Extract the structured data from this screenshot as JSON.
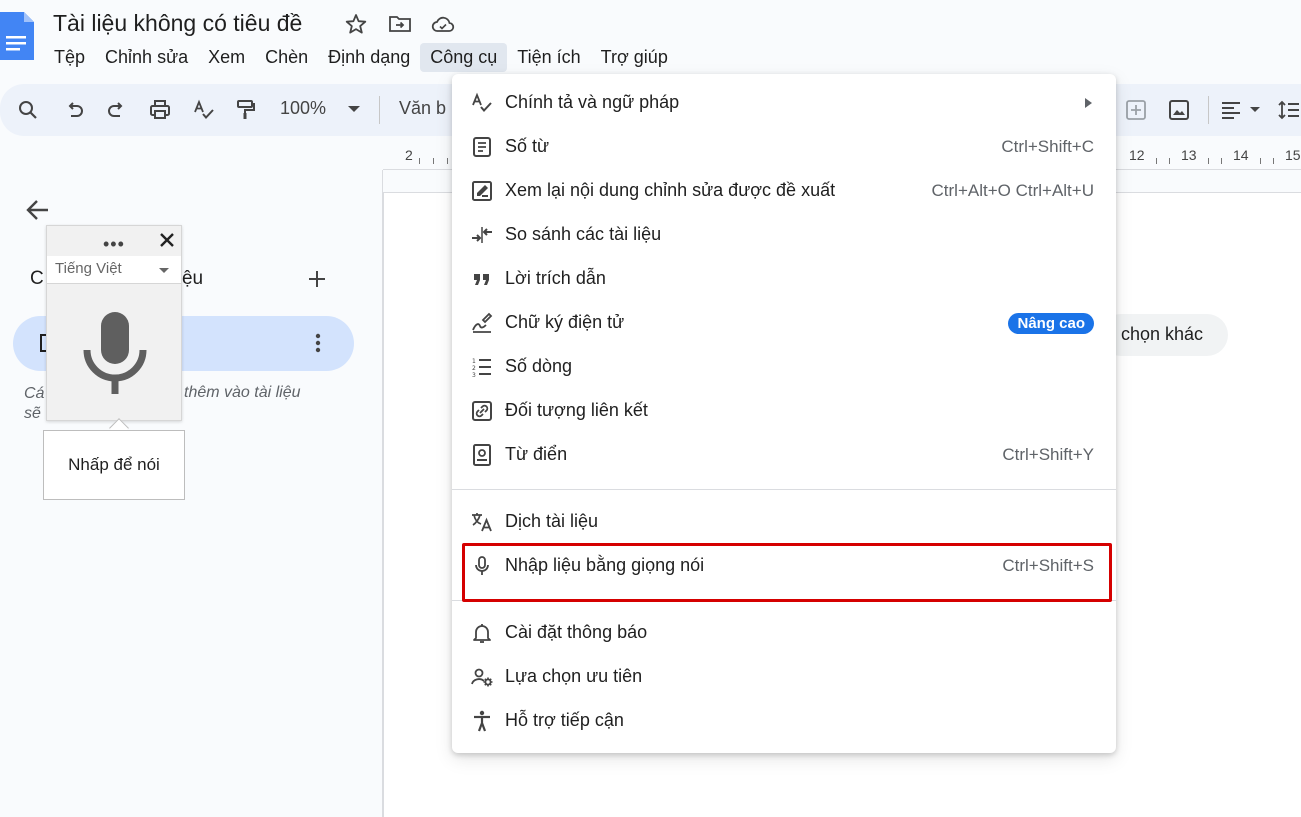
{
  "document": {
    "title": "Tài liệu không có tiêu đề"
  },
  "menubar": {
    "items": [
      "Tệp",
      "Chỉnh sửa",
      "Xem",
      "Chèn",
      "Định dạng",
      "Công cụ",
      "Tiện ích",
      "Trợ giúp"
    ],
    "active": "Công cụ"
  },
  "toolbar": {
    "zoom": "100%",
    "style_label": "Văn b"
  },
  "ruler": {
    "numbers": [
      "2",
      "12",
      "13",
      "14",
      "15"
    ]
  },
  "left_panel": {
    "heading_start": "C",
    "heading_end": "i liệu",
    "hint_start": "Cá",
    "hint_line2": "sẽ",
    "hint_end": "thêm vào tài liệu"
  },
  "page": {
    "chip_label": "chọn khác"
  },
  "voice_widget": {
    "dots": "•••",
    "language": "Tiếng Việt",
    "tooltip": "Nhấp để nói"
  },
  "tools_menu": {
    "items": [
      {
        "icon": "spellcheck-icon",
        "label": "Chính tả và ngữ pháp",
        "submenu": true
      },
      {
        "icon": "word-count-icon",
        "label": "Số từ",
        "shortcut": "Ctrl+Shift+C"
      },
      {
        "icon": "review-edits-icon",
        "label": "Xem lại nội dung chỉnh sửa được đề xuất",
        "shortcut": "Ctrl+Alt+O Ctrl+Alt+U"
      },
      {
        "icon": "compare-icon",
        "label": "So sánh các tài liệu"
      },
      {
        "icon": "quote-icon",
        "label": "Lời trích dẫn"
      },
      {
        "icon": "signature-icon",
        "label": "Chữ ký điện tử",
        "badge": "Nâng cao"
      },
      {
        "icon": "line-numbers-icon",
        "label": "Số dòng"
      },
      {
        "icon": "linked-object-icon",
        "label": "Đối tượng liên kết"
      },
      {
        "icon": "dictionary-icon",
        "label": "Từ điển",
        "shortcut": "Ctrl+Shift+Y"
      },
      {
        "icon": "translate-icon",
        "label": "Dịch tài liệu"
      },
      {
        "icon": "microphone-icon",
        "label": "Nhập liệu bằng giọng nói",
        "shortcut": "Ctrl+Shift+S"
      },
      {
        "icon": "bell-icon",
        "label": "Cài đặt thông báo"
      },
      {
        "icon": "preferences-icon",
        "label": "Lựa chọn ưu tiên"
      },
      {
        "icon": "accessibility-icon",
        "label": "Hỗ trợ tiếp cận"
      }
    ]
  },
  "colors": {
    "accent": "#1a73e8",
    "highlight": "#d50000",
    "tab_selected": "#d3e3fd",
    "toolbar_bg": "#edf2fa"
  }
}
